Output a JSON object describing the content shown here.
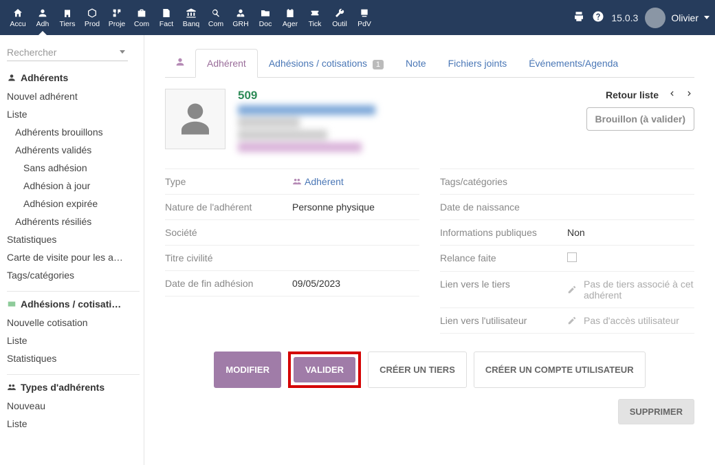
{
  "topnav": [
    {
      "label": "Accu",
      "icon": "home"
    },
    {
      "label": "Adh",
      "icon": "user",
      "active": true
    },
    {
      "label": "Tiers",
      "icon": "building"
    },
    {
      "label": "Prod",
      "icon": "cube"
    },
    {
      "label": "Proje",
      "icon": "project"
    },
    {
      "label": "Com",
      "icon": "briefcase"
    },
    {
      "label": "Fact",
      "icon": "invoice"
    },
    {
      "label": "Banq",
      "icon": "bank"
    },
    {
      "label": "Com",
      "icon": "search"
    },
    {
      "label": "GRH",
      "icon": "usertie"
    },
    {
      "label": "Doc",
      "icon": "folder"
    },
    {
      "label": "Ager",
      "icon": "calendar"
    },
    {
      "label": "Tick",
      "icon": "ticket"
    },
    {
      "label": "Outil",
      "icon": "wrench"
    },
    {
      "label": "PdV",
      "icon": "pos"
    }
  ],
  "version": "15.0.3",
  "user_name": "Olivier",
  "sidebar": {
    "search_placeholder": "Rechercher",
    "s1_title": "Adhérents",
    "s1_links": [
      "Nouvel adhérent",
      "Liste"
    ],
    "s1_sub": [
      "Adhérents brouillons",
      "Adhérents validés"
    ],
    "s1_sub2": [
      "Sans adhésion",
      "Adhésion à jour",
      "Adhésion expirée"
    ],
    "s1_sub_after": [
      "Adhérents résiliés"
    ],
    "s1_post": [
      "Statistiques",
      "Carte de visite pour les a…",
      "Tags/catégories"
    ],
    "s2_title": "Adhésions / cotisati…",
    "s2_links": [
      "Nouvelle cotisation",
      "Liste",
      "Statistiques"
    ],
    "s3_title": "Types d'adhérents",
    "s3_links": [
      "Nouveau",
      "Liste"
    ]
  },
  "tabs": {
    "t1": "Adhérent",
    "t2": "Adhésions / cotisations",
    "t2_badge": "1",
    "t3": "Note",
    "t4": "Fichiers joints",
    "t5": "Événements/Agenda"
  },
  "record": {
    "id": "509",
    "retour": "Retour liste",
    "status": "Brouillon (à valider)"
  },
  "left_rows": [
    {
      "lbl": "Type",
      "val": "Adhérent",
      "link": true,
      "icon": true
    },
    {
      "lbl": "Nature de l'adhérent",
      "val": "Personne physique"
    },
    {
      "lbl": "Société",
      "val": ""
    },
    {
      "lbl": "Titre civilité",
      "val": ""
    },
    {
      "lbl": "Date de fin adhésion",
      "val": "09/05/2023"
    }
  ],
  "right_rows": [
    {
      "lbl": "Tags/catégories",
      "val": ""
    },
    {
      "lbl": "Date de naissance",
      "val": ""
    },
    {
      "lbl": "Informations publiques",
      "val": "Non"
    },
    {
      "lbl": "Relance faite",
      "val": "",
      "checkbox": true
    },
    {
      "lbl": "Lien vers le tiers",
      "val": "Pas de tiers associé à cet adhérent",
      "edit": true,
      "grey": true
    },
    {
      "lbl": "Lien vers l'utilisateur",
      "val": "Pas d'accès utilisateur",
      "edit": true,
      "grey": true
    }
  ],
  "buttons": {
    "modifier": "MODIFIER",
    "valider": "VALIDER",
    "tiers": "CRÉER UN TIERS",
    "compte": "CRÉER UN COMPTE UTILISATEUR",
    "supprimer": "SUPPRIMER"
  }
}
